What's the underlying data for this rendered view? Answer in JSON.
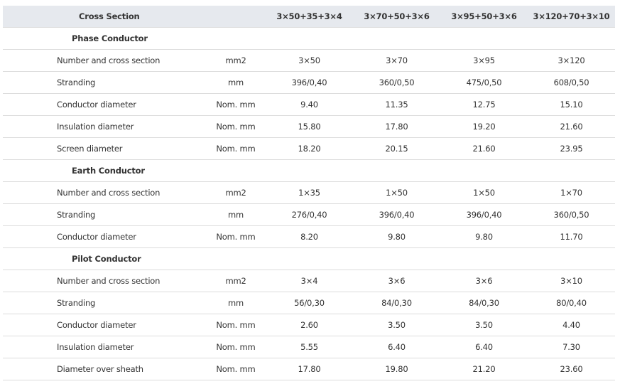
{
  "header": {
    "cross_section_label": "Cross Section",
    "unit_label": "",
    "columns": [
      "3×50+35+3×4",
      "3×70+50+3×6",
      "3×95+50+3×6",
      "3×120+70+3×10"
    ]
  },
  "sections": [
    {
      "title": "Phase Conductor",
      "rows": [
        {
          "param": "Number and cross section",
          "unit": "mm2",
          "values": [
            "3×50",
            "3×70",
            "3×95",
            "3×120"
          ]
        },
        {
          "param": "Stranding",
          "unit": "mm",
          "values": [
            "396/0,40",
            "360/0,50",
            "475/0,50",
            "608/0,50"
          ]
        },
        {
          "param": "Conductor diameter",
          "unit": "Nom. mm",
          "values": [
            "9.40",
            "11.35",
            "12.75",
            "15.10"
          ]
        },
        {
          "param": "Insulation diameter",
          "unit": "Nom. mm",
          "values": [
            "15.80",
            "17.80",
            "19.20",
            "21.60"
          ]
        },
        {
          "param": "Screen diameter",
          "unit": "Nom. mm",
          "values": [
            "18.20",
            "20.15",
            "21.60",
            "23.95"
          ]
        }
      ]
    },
    {
      "title": "Earth Conductor",
      "rows": [
        {
          "param": "Number and cross section",
          "unit": "mm2",
          "values": [
            "1×35",
            "1×50",
            "1×50",
            "1×70"
          ]
        },
        {
          "param": "Stranding",
          "unit": "mm",
          "values": [
            "276/0,40",
            "396/0,40",
            "396/0,40",
            "360/0,50"
          ]
        },
        {
          "param": "Conductor diameter",
          "unit": "Nom. mm",
          "values": [
            "8.20",
            "9.80",
            "9.80",
            "11.70"
          ]
        }
      ]
    },
    {
      "title": "Pilot Conductor",
      "rows": [
        {
          "param": "Number and cross section",
          "unit": "mm2",
          "values": [
            "3×4",
            "3×6",
            "3×6",
            "3×10"
          ]
        },
        {
          "param": "Stranding",
          "unit": "mm",
          "values": [
            "56/0,30",
            "84/0,30",
            "84/0,30",
            "80/0,40"
          ]
        },
        {
          "param": "Conductor diameter",
          "unit": "Nom. mm",
          "values": [
            "2.60",
            "3.50",
            "3.50",
            "4.40"
          ]
        },
        {
          "param": "Insulation diameter",
          "unit": "Nom. mm",
          "values": [
            "5.55",
            "6.40",
            "6.40",
            "7.30"
          ]
        },
        {
          "param": "Diameter over sheath",
          "unit": "Nom. mm",
          "values": [
            "17.80",
            "19.80",
            "21.20",
            "23.60"
          ]
        }
      ]
    }
  ],
  "colors": {
    "header_bg": "#e6e9ee",
    "row_border": "#dcdcdc",
    "text": "#333333"
  }
}
